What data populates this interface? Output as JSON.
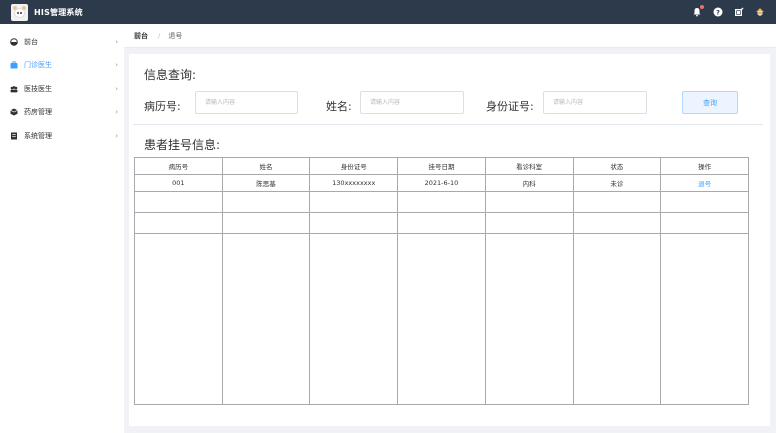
{
  "app": {
    "title": "HIS管理系统"
  },
  "topbar": {
    "icons": [
      "bell-icon",
      "help-icon",
      "edit-icon",
      "avatar-icon"
    ]
  },
  "sidebar": {
    "items": [
      {
        "label": "前台",
        "icon": "dashboard-icon",
        "active": false
      },
      {
        "label": "门诊医生",
        "icon": "briefcase-icon",
        "active": true
      },
      {
        "label": "医技医生",
        "icon": "team-icon",
        "active": false
      },
      {
        "label": "药房管理",
        "icon": "box-icon",
        "active": false
      },
      {
        "label": "系统管理",
        "icon": "document-icon",
        "active": false
      }
    ]
  },
  "breadcrumb": {
    "home": "前台",
    "current": "退号"
  },
  "search": {
    "title": "信息查询:",
    "record_label": "病历号:",
    "name_label": "姓名:",
    "id_label": "身份证号:",
    "placeholder": "请输入内容",
    "button": "查询"
  },
  "results": {
    "title": "患者挂号信息:",
    "columns": [
      "病历号",
      "姓名",
      "身份证号",
      "挂号日期",
      "看诊科室",
      "状态",
      "操作"
    ],
    "rows": [
      {
        "record": "001",
        "name": "陈思基",
        "id": "130xxxxxxxx",
        "date": "2021-6-10",
        "dept": "内科",
        "status": "未诊",
        "action": "退号"
      }
    ]
  },
  "colors": {
    "accent": "#409eff",
    "topbar": "#2d3a4b"
  }
}
